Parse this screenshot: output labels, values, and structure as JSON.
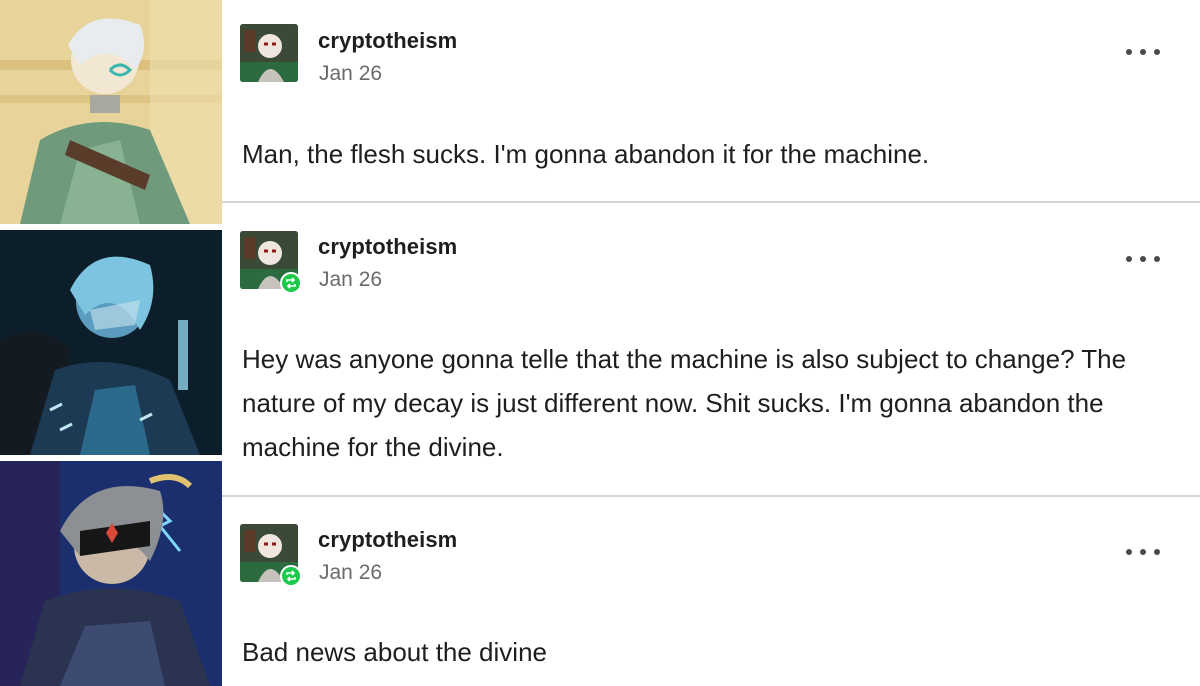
{
  "posts": [
    {
      "username": "cryptotheism",
      "date": "Jan 26",
      "text": "Man, the flesh sucks. I'm gonna abandon it for the machine.",
      "reblogged": false
    },
    {
      "username": "cryptotheism",
      "date": "Jan 26",
      "text": "Hey was anyone gonna telle that the machine is also subject to change? The nature of my decay is just different now. Shit sucks. I'm gonna abandon the machine for the divine.",
      "reblogged": true
    },
    {
      "username": "cryptotheism",
      "date": "Jan 26",
      "text": "Bad news about the divine",
      "reblogged": true
    }
  ],
  "colors": {
    "reblog_badge": "#1dc94a",
    "divider": "#d6d6d6",
    "date_text": "#6b6b6b"
  },
  "icons": {
    "more": "more-options-icon",
    "reblog": "reblog-icon"
  }
}
